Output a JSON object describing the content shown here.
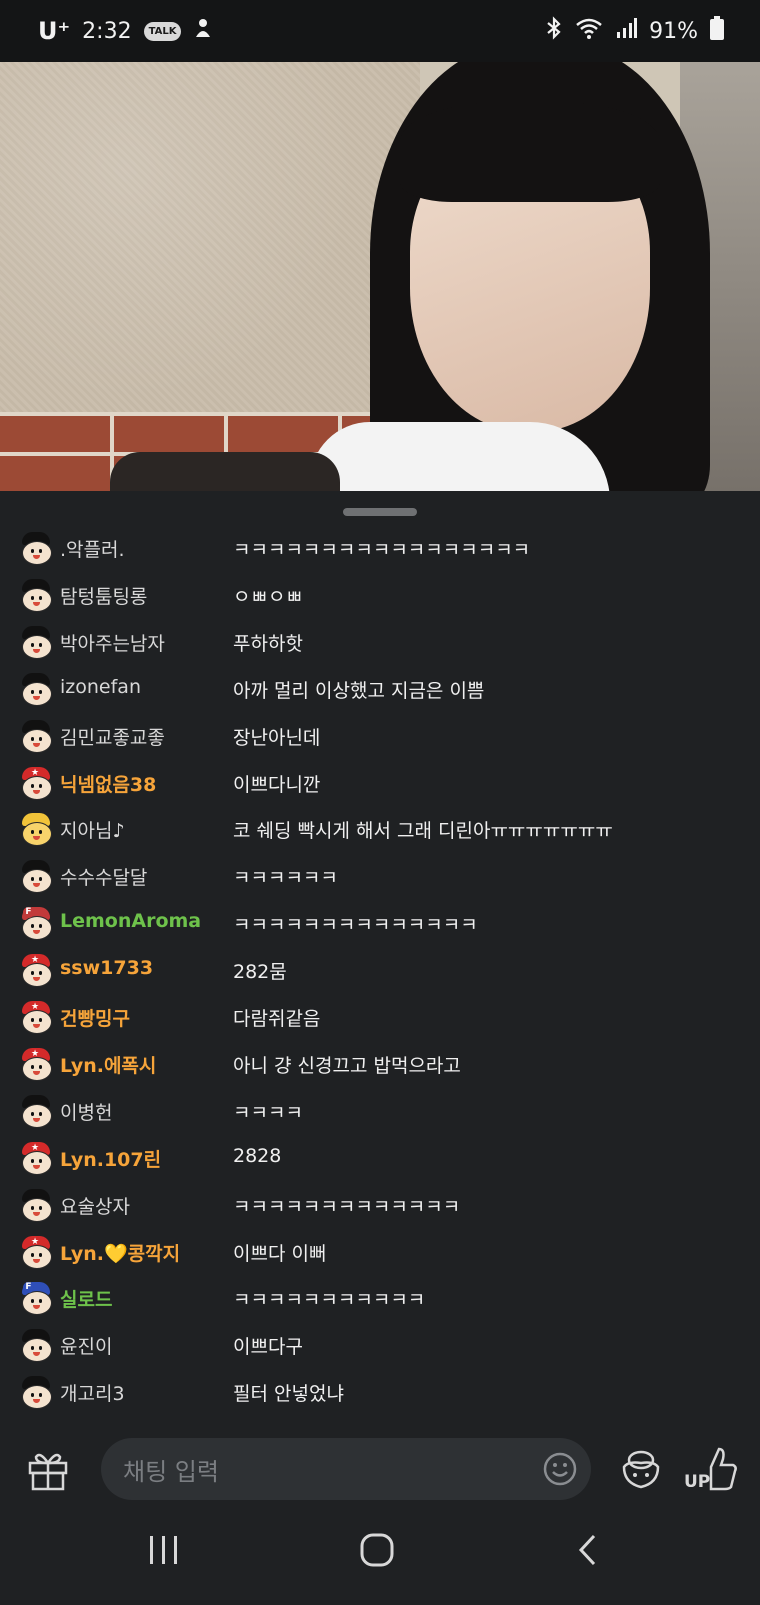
{
  "status_bar": {
    "carrier": "U⁺",
    "time": "2:32",
    "talk_badge": "TALK",
    "battery": "91%"
  },
  "chat": {
    "messages": [
      {
        "nick": ".악플러.",
        "text": "ㅋㅋㅋㅋㅋㅋㅋㅋㅋㅋㅋㅋㅋㅋㅋㅋㅋ",
        "badge": "default",
        "nick_style": "normal"
      },
      {
        "nick": "탐텅툼팅롱",
        "text": "ㅇㅃㅇㅃ",
        "badge": "default",
        "nick_style": "normal"
      },
      {
        "nick": "박아주는남자",
        "text": "푸하하핫",
        "badge": "default",
        "nick_style": "normal"
      },
      {
        "nick": "izonefan",
        "text": "아까 멀리 이상했고 지금은 이쁨",
        "badge": "default",
        "nick_style": "normal"
      },
      {
        "nick": "김민교좋교좋",
        "text": "장난아닌데",
        "badge": "default",
        "nick_style": "normal"
      },
      {
        "nick": "닉넴없음38",
        "text": "이쁘다니깐",
        "badge": "red",
        "nick_style": "orange"
      },
      {
        "nick": "지아님♪",
        "text": "코 쉐딩 빡시게 해서 그래 디린아ㅠㅠㅠㅠㅠㅠㅠ",
        "badge": "gold",
        "nick_style": "normal"
      },
      {
        "nick": "수수수달달",
        "text": "ㅋㅋㅋㅋㅋㅋ",
        "badge": "default",
        "nick_style": "normal"
      },
      {
        "nick": "LemonAroma",
        "text": "ㅋㅋㅋㅋㅋㅋㅋㅋㅋㅋㅋㅋㅋㅋ",
        "badge": "fanf",
        "nick_style": "green"
      },
      {
        "nick": "ssw1733",
        "text": "282뭄",
        "badge": "red",
        "nick_style": "orange"
      },
      {
        "nick": "건빵밍구",
        "text": "다람쥐같음",
        "badge": "red",
        "nick_style": "orange"
      },
      {
        "nick": "Lyn.에폭시",
        "text": "아니 걍 신경끄고 밥먹으라고",
        "badge": "red",
        "nick_style": "orange"
      },
      {
        "nick": "이병헌",
        "text": "ㅋㅋㅋㅋ",
        "badge": "default",
        "nick_style": "normal"
      },
      {
        "nick": "Lyn.107린",
        "text": "2828",
        "badge": "red",
        "nick_style": "orange"
      },
      {
        "nick": "요술상자",
        "text": "ㅋㅋㅋㅋㅋㅋㅋㅋㅋㅋㅋㅋㅋ",
        "badge": "default",
        "nick_style": "normal"
      },
      {
        "nick": "Lyn.💛콩깍지",
        "text": "이쁘다 이뻐",
        "badge": "red",
        "nick_style": "orange"
      },
      {
        "nick": "실로드",
        "text": "ㅋㅋㅋㅋㅋㅋㅋㅋㅋㅋㅋ",
        "badge": "fanb",
        "nick_style": "green"
      },
      {
        "nick": "윤진이",
        "text": "이쁘다구",
        "badge": "default",
        "nick_style": "normal"
      },
      {
        "nick": "개고리3",
        "text": "필터 안넣었냐",
        "badge": "default",
        "nick_style": "normal"
      }
    ]
  },
  "input": {
    "placeholder": "채팅 입력",
    "up_label": "UP"
  },
  "colors": {
    "background": "#1f2123",
    "fan_nick": "#f6a43a",
    "vip_nick": "#6ec24b",
    "input_bg": "#2e3134"
  },
  "icons": [
    "kakaotalk-icon",
    "notification-icon",
    "bluetooth-icon",
    "wifi-icon",
    "signal-icon",
    "battery-icon",
    "gift-icon",
    "emoji-icon",
    "balloon-icon",
    "thumbs-up-icon",
    "recent-apps-icon",
    "home-icon",
    "back-icon"
  ]
}
